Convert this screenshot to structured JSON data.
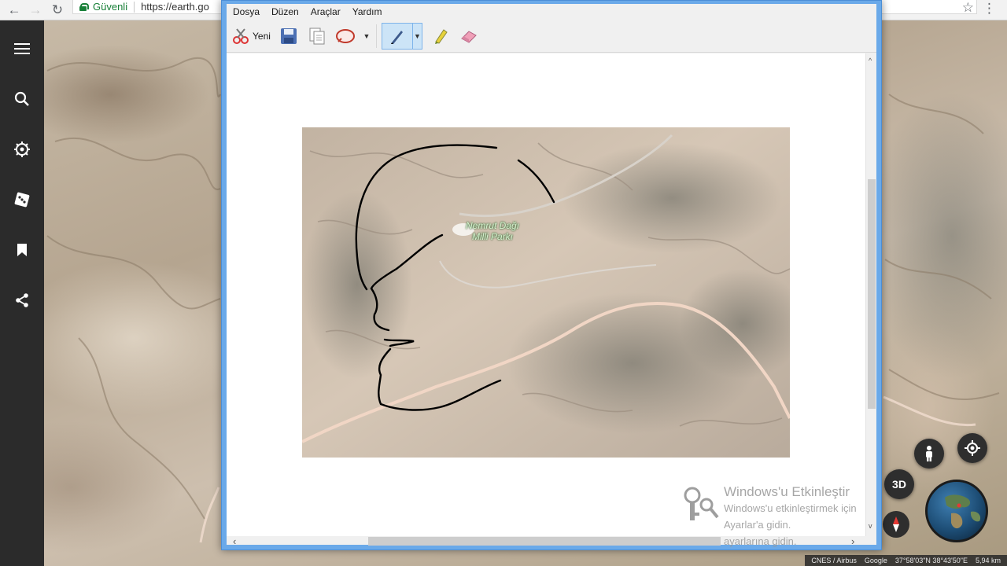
{
  "browser": {
    "secure_label": "Güvenli",
    "url": "https://earth.go",
    "back_glyph": "←",
    "forward_glyph": "→",
    "reload_glyph": "↻",
    "star_glyph": "☆",
    "menu_glyph": "⋮"
  },
  "earth": {
    "rail_icons": [
      "menu-icon",
      "search-icon",
      "voyager-icon",
      "dice-icon",
      "bookmark-icon",
      "share-icon"
    ],
    "btn_3d": "3D",
    "status": {
      "attribution": "CNES / Airbus",
      "provider": "Google",
      "coordinates": "37°58'03\"N 38°43'50\"E",
      "scale": "5,94 km"
    }
  },
  "paint": {
    "menus": [
      "Dosya",
      "Düzen",
      "Araçlar",
      "Yardım"
    ],
    "toolbar": {
      "new_label": "Yeni",
      "tools": [
        "new-icon",
        "save-icon",
        "copy-icon",
        "lasso-icon",
        "pen-icon",
        "highlighter-icon",
        "eraser-icon"
      ]
    },
    "map_label_line1": "Nemrut Dağı",
    "map_label_line2": "Milli Parkı",
    "scroll_left": "‹",
    "scroll_right": "›",
    "scroll_up": "^",
    "scroll_down": "v"
  },
  "watermark": {
    "title": "Windows'u Etkinleştir",
    "line1": "Windows'u etkinleştirmek için Ayarlar'a gidin.",
    "line2": "ayarlarına gidin."
  },
  "colors": {
    "rail": "#2b2b2b",
    "paint_frame": "#6aa9e9",
    "secure_green": "#188038",
    "ink": "#000000",
    "road": "#f3d7c4"
  }
}
